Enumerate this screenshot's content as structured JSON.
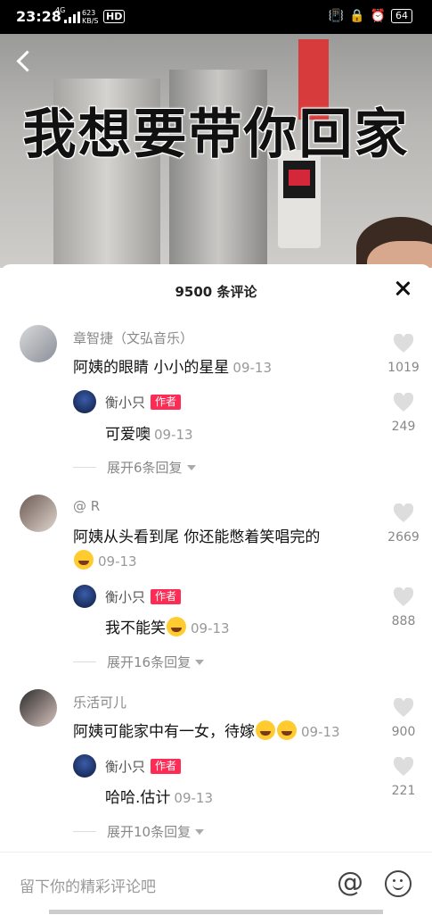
{
  "status_bar": {
    "time": "23:28",
    "net": "4G",
    "speed_value": "623",
    "speed_unit": "KB/S",
    "hd": "HD",
    "battery": "64"
  },
  "video": {
    "caption": "我想要带你回家"
  },
  "sheet": {
    "title": "9500 条评论"
  },
  "comments": [
    {
      "user": "章智捷（文弘音乐）",
      "text": "阿姨的眼睛 小小的星星",
      "date": "09-13",
      "likes": "1019",
      "reply": {
        "user": "衡小只",
        "tag": "作者",
        "text": "可爱噢",
        "date": "09-13",
        "likes": "249"
      },
      "expand": "展开6条回复"
    },
    {
      "user": "@ R",
      "text": "阿姨从头看到尾 你还能憋着笑唱完的",
      "date": "09-13",
      "likes": "2669",
      "reply": {
        "user": "衡小只",
        "tag": "作者",
        "text": "我不能笑",
        "date": "09-13",
        "likes": "888"
      },
      "expand": "展开16条回复"
    },
    {
      "user": "乐活可儿",
      "text": "阿姨可能家中有一女，待嫁",
      "date": "09-13",
      "likes": "900",
      "reply": {
        "user": "衡小只",
        "tag": "作者",
        "text": "哈哈.估计",
        "date": "09-13",
        "likes": "221"
      },
      "expand": "展开10条回复"
    }
  ],
  "input": {
    "placeholder": "留下你的精彩评论吧",
    "at_symbol": "@"
  }
}
